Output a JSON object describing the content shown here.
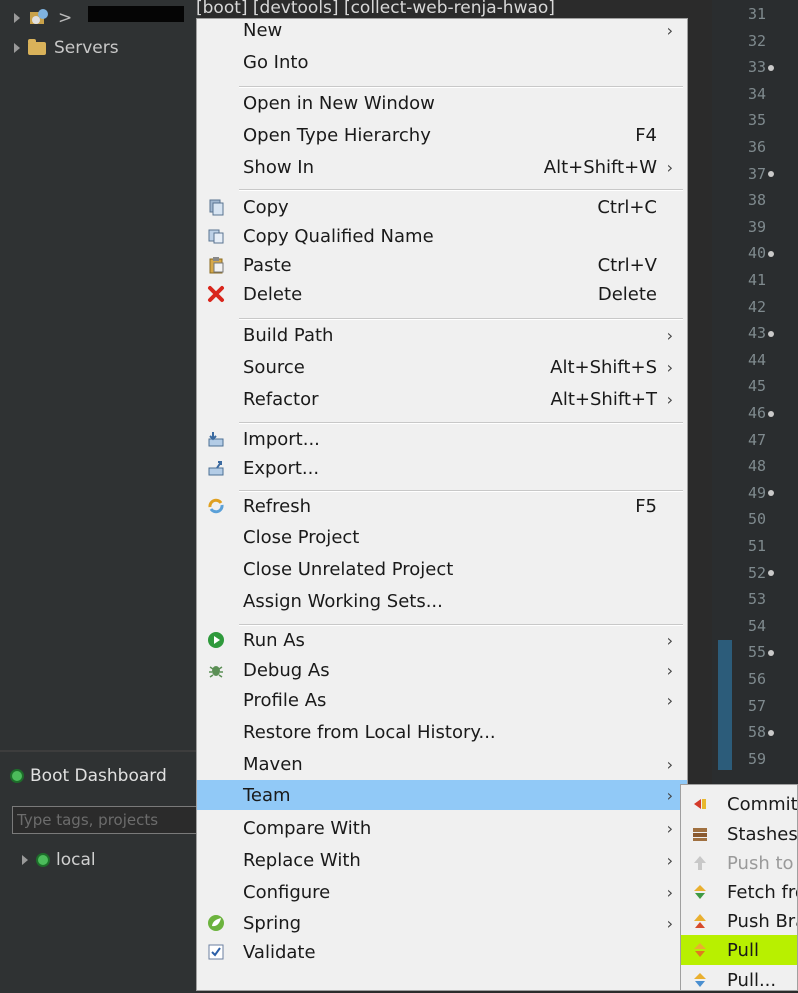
{
  "explorer": {
    "top_path_text": "[boot] [devtools] [collect-web-renja-hwao]",
    "servers_label": "Servers"
  },
  "boot_dashboard": {
    "title": "Boot Dashboard",
    "search_placeholder": "Type tags, projects",
    "local_label": "local"
  },
  "editor": {
    "line_numbers": [
      "31",
      "32",
      "33",
      "34",
      "35",
      "36",
      "37",
      "38",
      "39",
      "40",
      "41",
      "42",
      "43",
      "44",
      "45",
      "46",
      "47",
      "48",
      "49",
      "50",
      "51",
      "52",
      "53",
      "54",
      "55",
      "56",
      "57",
      "58",
      "59"
    ]
  },
  "context_menu": {
    "items": [
      {
        "label": "New",
        "shortcut": "",
        "submenu": true,
        "icon": ""
      },
      {
        "label": "Go Into",
        "shortcut": "",
        "submenu": false,
        "icon": ""
      },
      {
        "label": "Open in New Window",
        "shortcut": "",
        "submenu": false,
        "icon": ""
      },
      {
        "label": "Open Type Hierarchy",
        "shortcut": "F4",
        "submenu": false,
        "icon": ""
      },
      {
        "label": "Show In",
        "shortcut": "Alt+Shift+W",
        "submenu": true,
        "icon": ""
      },
      {
        "label": "Copy",
        "shortcut": "Ctrl+C",
        "submenu": false,
        "icon": "copy-icon"
      },
      {
        "label": "Copy Qualified Name",
        "shortcut": "",
        "submenu": false,
        "icon": "copy-qualified-icon"
      },
      {
        "label": "Paste",
        "shortcut": "Ctrl+V",
        "submenu": false,
        "icon": "paste-icon"
      },
      {
        "label": "Delete",
        "shortcut": "Delete",
        "submenu": false,
        "icon": "delete-icon"
      },
      {
        "label": "Build Path",
        "shortcut": "",
        "submenu": true,
        "icon": ""
      },
      {
        "label": "Source",
        "shortcut": "Alt+Shift+S",
        "submenu": true,
        "icon": ""
      },
      {
        "label": "Refactor",
        "shortcut": "Alt+Shift+T",
        "submenu": true,
        "icon": ""
      },
      {
        "label": "Import...",
        "shortcut": "",
        "submenu": false,
        "icon": "import-icon"
      },
      {
        "label": "Export...",
        "shortcut": "",
        "submenu": false,
        "icon": "export-icon"
      },
      {
        "label": "Refresh",
        "shortcut": "F5",
        "submenu": false,
        "icon": "refresh-icon"
      },
      {
        "label": "Close Project",
        "shortcut": "",
        "submenu": false,
        "icon": ""
      },
      {
        "label": "Close Unrelated Project",
        "shortcut": "",
        "submenu": false,
        "icon": ""
      },
      {
        "label": "Assign Working Sets...",
        "shortcut": "",
        "submenu": false,
        "icon": ""
      },
      {
        "label": "Run As",
        "shortcut": "",
        "submenu": true,
        "icon": "run-icon"
      },
      {
        "label": "Debug As",
        "shortcut": "",
        "submenu": true,
        "icon": "debug-icon"
      },
      {
        "label": "Profile As",
        "shortcut": "",
        "submenu": true,
        "icon": ""
      },
      {
        "label": "Restore from Local History...",
        "shortcut": "",
        "submenu": false,
        "icon": ""
      },
      {
        "label": "Maven",
        "shortcut": "",
        "submenu": true,
        "icon": ""
      },
      {
        "label": "Team",
        "shortcut": "",
        "submenu": true,
        "icon": "",
        "highlighted": true
      },
      {
        "label": "Compare With",
        "shortcut": "",
        "submenu": true,
        "icon": ""
      },
      {
        "label": "Replace With",
        "shortcut": "",
        "submenu": true,
        "icon": ""
      },
      {
        "label": "Configure",
        "shortcut": "",
        "submenu": true,
        "icon": ""
      },
      {
        "label": "Spring",
        "shortcut": "",
        "submenu": true,
        "icon": "spring-icon"
      },
      {
        "label": "Validate",
        "shortcut": "",
        "submenu": false,
        "icon": "validate-checkbox-icon"
      }
    ]
  },
  "team_submenu": {
    "items": [
      {
        "label": "Commit...",
        "icon": "commit-icon",
        "disabled": false
      },
      {
        "label": "Stashes",
        "icon": "stashes-icon",
        "disabled": false
      },
      {
        "label": "Push to Upstream",
        "icon": "push-icon",
        "disabled": true
      },
      {
        "label": "Fetch from Upstream",
        "icon": "fetch-icon",
        "disabled": false
      },
      {
        "label": "Push Branch...",
        "icon": "push-branch-icon",
        "disabled": false
      },
      {
        "label": "Pull",
        "icon": "pull-icon",
        "disabled": false,
        "highlighted": true
      },
      {
        "label": "Pull...",
        "icon": "pull-dialog-icon",
        "disabled": false
      }
    ]
  },
  "colors": {
    "menu_highlight": "#91c9f7",
    "pull_highlight": "#b8f000",
    "dark_bg": "#2b2b2b"
  }
}
